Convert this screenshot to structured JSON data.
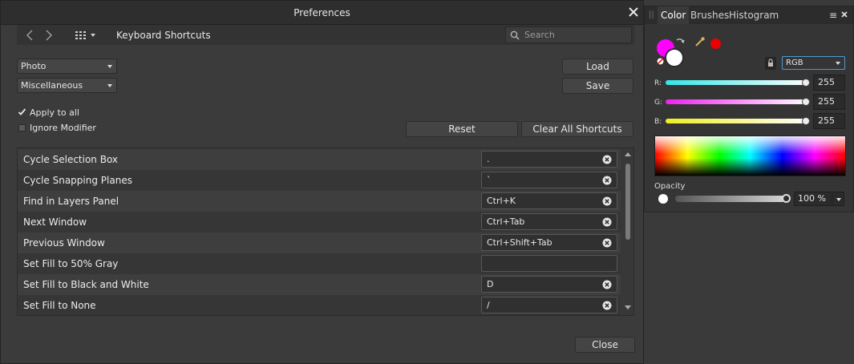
{
  "preferences": {
    "title": "Preferences",
    "section": "Keyboard Shortcuts",
    "search_placeholder": "Search",
    "category_dropdown": "Photo",
    "subcategory_dropdown": "Miscellaneous",
    "apply_to_all_label": "Apply to all",
    "apply_to_all_checked": true,
    "ignore_modifier_label": "Ignore Modifier",
    "ignore_modifier_checked": false,
    "load_label": "Load",
    "save_label": "Save",
    "reset_label": "Reset",
    "clear_all_label": "Clear All Shortcuts",
    "close_label": "Close",
    "shortcuts": [
      {
        "name": "Cycle Selection Box",
        "keys": "."
      },
      {
        "name": "Cycle Snapping Planes",
        "keys": "`"
      },
      {
        "name": "Find in Layers Panel",
        "keys": "Ctrl+K"
      },
      {
        "name": "Next Window",
        "keys": "Ctrl+Tab"
      },
      {
        "name": "Previous Window",
        "keys": "Ctrl+Shift+Tab"
      },
      {
        "name": "Set Fill to 50% Gray",
        "keys": ""
      },
      {
        "name": "Set Fill to Black and White",
        "keys": "D"
      },
      {
        "name": "Set Fill to None",
        "keys": "/"
      }
    ]
  },
  "color_panel": {
    "tabs": [
      "Color",
      "Brushes",
      "Histogram"
    ],
    "active_tab": "Color",
    "menu_icon": "≡",
    "fill_color": "#ff00ff",
    "stroke_color": "#ffffff",
    "recent_color": "#ee0000",
    "model": "RGB",
    "channels": [
      {
        "label": "R:",
        "value": "255",
        "color": "#33e6e6"
      },
      {
        "label": "G:",
        "value": "255",
        "color": "#ee22ee"
      },
      {
        "label": "B:",
        "value": "255",
        "color": "#eeee22"
      }
    ],
    "opacity_label": "Opacity",
    "opacity_value": "100 %"
  }
}
